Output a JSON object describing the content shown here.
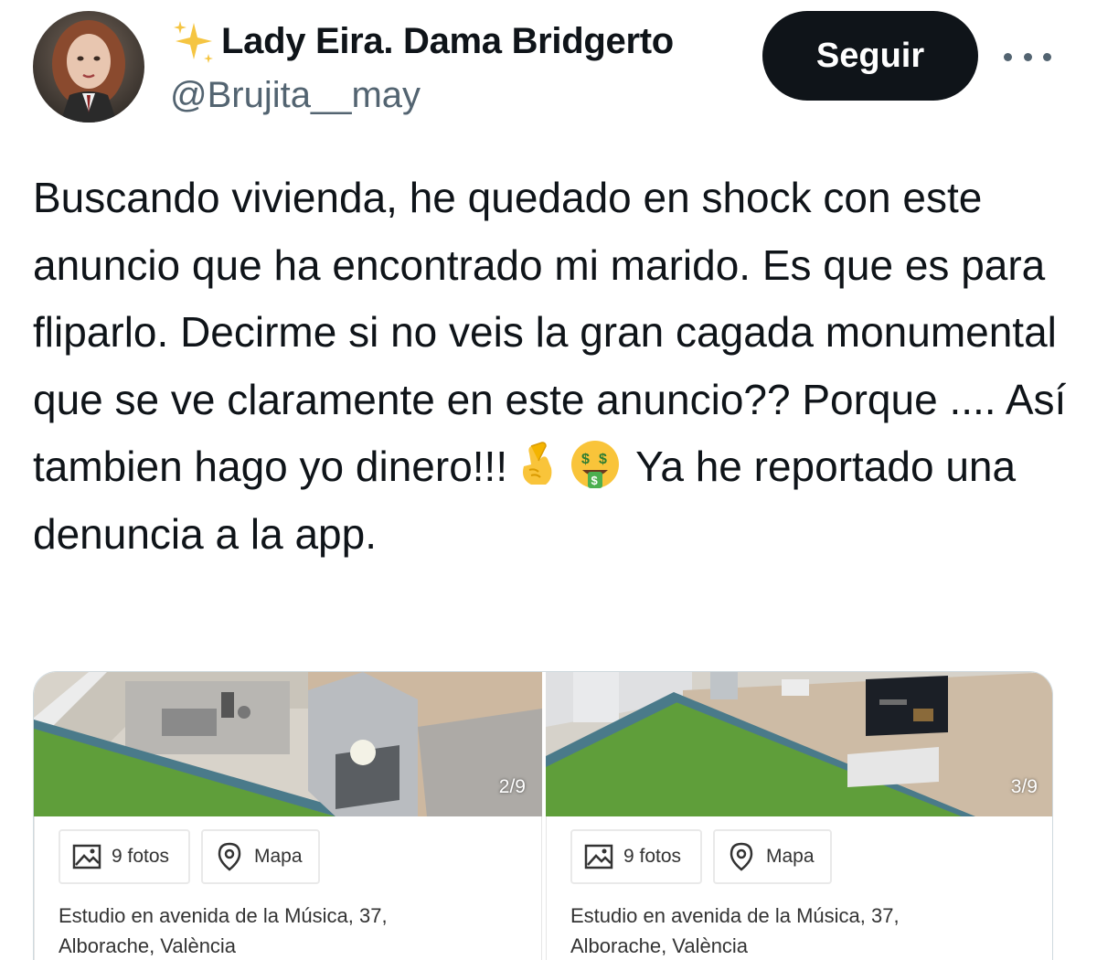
{
  "author": {
    "display_name": "Lady Eira. Dama Bridgerto",
    "handle": "@Brujita__may",
    "avatar_icon": "profile-photo",
    "name_prefix_icon": "sparkles-icon"
  },
  "actions": {
    "follow_label": "Seguir",
    "more_icon": "more-options-icon"
  },
  "tweet": {
    "text_part1": "Buscando vivienda, he quedado en shock con este anuncio que ha encontrado mi marido. Es que es para fliparlo. Decirme si no veis la gran cagada monumental que se ve claramente en este anuncio?? Porque .... Así tambien hago yo dinero!!!",
    "emoji_1": "crossed-fingers-emoji",
    "emoji_2": "money-mouth-face-emoji",
    "text_part2": "Ya he reportado una denuncia a la app."
  },
  "media": [
    {
      "counter": "2/9",
      "photos_label": "9 fotos",
      "map_label": "Mapa",
      "address_line1": "Estudio en avenida de la Música, 37,",
      "address_line2": "Alborache, València"
    },
    {
      "counter": "3/9",
      "photos_label": "9 fotos",
      "map_label": "Mapa",
      "address_line1": "Estudio en avenida de la Música, 37,",
      "address_line2": "Alborache, València"
    }
  ],
  "colors": {
    "follow_button_bg": "#0f1419",
    "handle_text": "#536471",
    "lawn_green": "#5f9e3a"
  }
}
